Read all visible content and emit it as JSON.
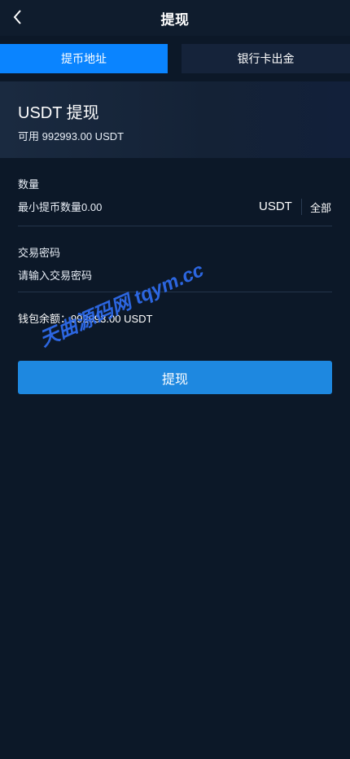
{
  "header": {
    "title": "提现",
    "back_icon": "chevron-left-icon"
  },
  "tabs": [
    {
      "label": "提币地址",
      "active": true
    },
    {
      "label": "银行卡出金",
      "active": false
    }
  ],
  "summary": {
    "title": "USDT 提现",
    "available": "可用 992993.00 USDT"
  },
  "form": {
    "amount": {
      "label": "数量",
      "placeholder": "最小提币数量0.00",
      "unit": "USDT",
      "all_label": "全部"
    },
    "password": {
      "label": "交易密码",
      "placeholder": "请输入交易密码"
    },
    "balance_text": "钱包余额：992993.00 USDT"
  },
  "submit_label": "提现",
  "watermark": "天曲源码网 tqym.cc",
  "colors": {
    "background": "#0c1828",
    "accent_tab": "#0a84ff",
    "button": "#1e88e0",
    "watermark": "#2f6df0"
  }
}
